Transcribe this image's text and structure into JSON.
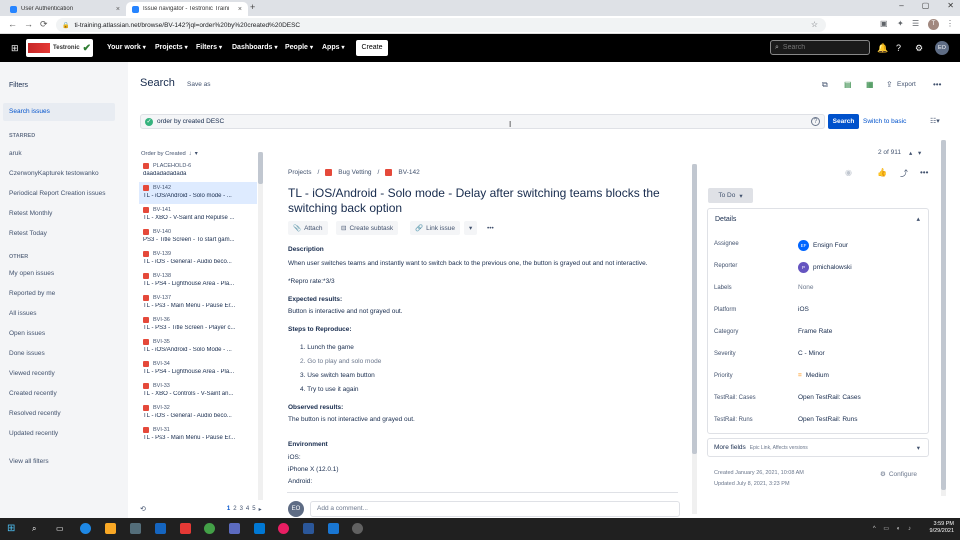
{
  "browser": {
    "tabs": [
      {
        "title": "User Authentication",
        "active": false
      },
      {
        "title": "Issue navigator - Testronic Traini",
        "active": true
      }
    ],
    "url": "ti-training.atlassian.net/browse/BV-142?jql=order%20by%20created%20DESC"
  },
  "topnav": {
    "logo_text": "Testronic",
    "items": [
      "Your work",
      "Projects",
      "Filters",
      "Dashboards",
      "People",
      "Apps"
    ],
    "create_label": "Create",
    "search_placeholder": "Search",
    "user_initials": "EO"
  },
  "sidebar": {
    "title": "Filters",
    "search_issues": "Search issues",
    "starred_heading": "STARRED",
    "starred": [
      "aruk",
      "CzerwonyKapturek testowanko",
      "Periodical Report Creation issues",
      "Retest Monthly",
      "Retest Today"
    ],
    "other_heading": "OTHER",
    "other": [
      "My open issues",
      "Reported by me",
      "All issues",
      "Open issues",
      "Done issues",
      "Viewed recently",
      "Created recently",
      "Resolved recently",
      "Updated recently"
    ],
    "view_all": "View all filters"
  },
  "header": {
    "title": "Search",
    "save_as": "Save as",
    "export": "Export"
  },
  "jql": {
    "query": "order by created DESC",
    "search_button": "Search",
    "switch_basic": "Switch to basic"
  },
  "list": {
    "sort_label": "Order by Created",
    "items": [
      {
        "key": "PLACEHOLD-6",
        "summary": "daadadadadada"
      },
      {
        "key": "BV-142",
        "summary": "TL - iOS/Android - Solo mode - ..."
      },
      {
        "key": "BV-141",
        "summary": "TL - XBO - V-Saint and Repulse ..."
      },
      {
        "key": "BV-140",
        "summary": "PS3 - Title Screen - To start gam..."
      },
      {
        "key": "BV-139",
        "summary": "TL - iOS - General - Audio beco..."
      },
      {
        "key": "BV-138",
        "summary": "TL - PS4 - Lighthouse Area - Pla..."
      },
      {
        "key": "BV-137",
        "summary": "TL - Ps3 - Main Menu - Pause Er..."
      },
      {
        "key": "BVI-36",
        "summary": "TL - PS3 - Title Screen - Player c..."
      },
      {
        "key": "BVI-35",
        "summary": "TL - iOS/Android - Solo Mode - ..."
      },
      {
        "key": "BVI-34",
        "summary": "TL - PS4 - Lighthouse Area - Pla..."
      },
      {
        "key": "BVI-33",
        "summary": "TL - XBO - Controls - V-Saint an..."
      },
      {
        "key": "BVI-32",
        "summary": "TL - iOS - General - Audio beco..."
      },
      {
        "key": "BVI-31",
        "summary": "TL - Ps3 - Main Menu - Pause Er..."
      }
    ],
    "pages": [
      "1",
      "2",
      "3",
      "4",
      "5"
    ],
    "current_page": "1"
  },
  "issue": {
    "breadcrumb": [
      "Projects",
      "Bug Vetting",
      "BV-142"
    ],
    "counter": "2 of 911",
    "title": "TL - iOS/Android - Solo mode - Delay after switching teams blocks the switching back option",
    "actions": [
      "Attach",
      "Create subtask",
      "Link issue"
    ],
    "status": "To Do",
    "description_heading": "Description",
    "description": "When user switches teams and instantly want to switch back to the previous one, the button is grayed out and not interactive.",
    "repro_rate": "*Repro rate:*3/3",
    "expected_heading": "Expected results:",
    "expected": "Button is interactive and not grayed out.",
    "steps_heading": "Steps to Reproduce:",
    "steps": [
      "Lunch the game",
      "Go to play and solo mode",
      "Use switch team button",
      "Try to use it again"
    ],
    "observed_heading": "Observed results:",
    "observed": "The button is not interactive and grayed out.",
    "environment_heading": "Environment",
    "environment": [
      "iOS:",
      "iPhone X (12.0.1)",
      "Android:"
    ],
    "comment_placeholder": "Add a comment...",
    "commenter_initials": "EO"
  },
  "details": {
    "heading": "Details",
    "fields": [
      {
        "label": "Assignee",
        "value": "Ensign Four",
        "avatar": "EF",
        "avatar_color": "#0065ff"
      },
      {
        "label": "Reporter",
        "value": "pmichalowski",
        "avatar": "P",
        "avatar_color": "#6554c0"
      },
      {
        "label": "Labels",
        "value": "None"
      },
      {
        "label": "Platform",
        "value": "iOS"
      },
      {
        "label": "Category",
        "value": "Frame Rate"
      },
      {
        "label": "Severity",
        "value": "C - Minor"
      },
      {
        "label": "Priority",
        "value": "Medium"
      },
      {
        "label": "TestRail: Cases",
        "value": "Open TestRail: Cases"
      },
      {
        "label": "TestRail: Runs",
        "value": "Open TestRail: Runs"
      }
    ],
    "more_fields": "More fields",
    "more_fields_sub": "Epic Link, Affects versions",
    "created": "Created January 26, 2021, 10:08 AM",
    "updated": "Updated July 8, 2021, 3:23 PM",
    "configure": "Configure"
  },
  "taskbar": {
    "time": "3:59 PM",
    "date": "9/29/2021"
  }
}
